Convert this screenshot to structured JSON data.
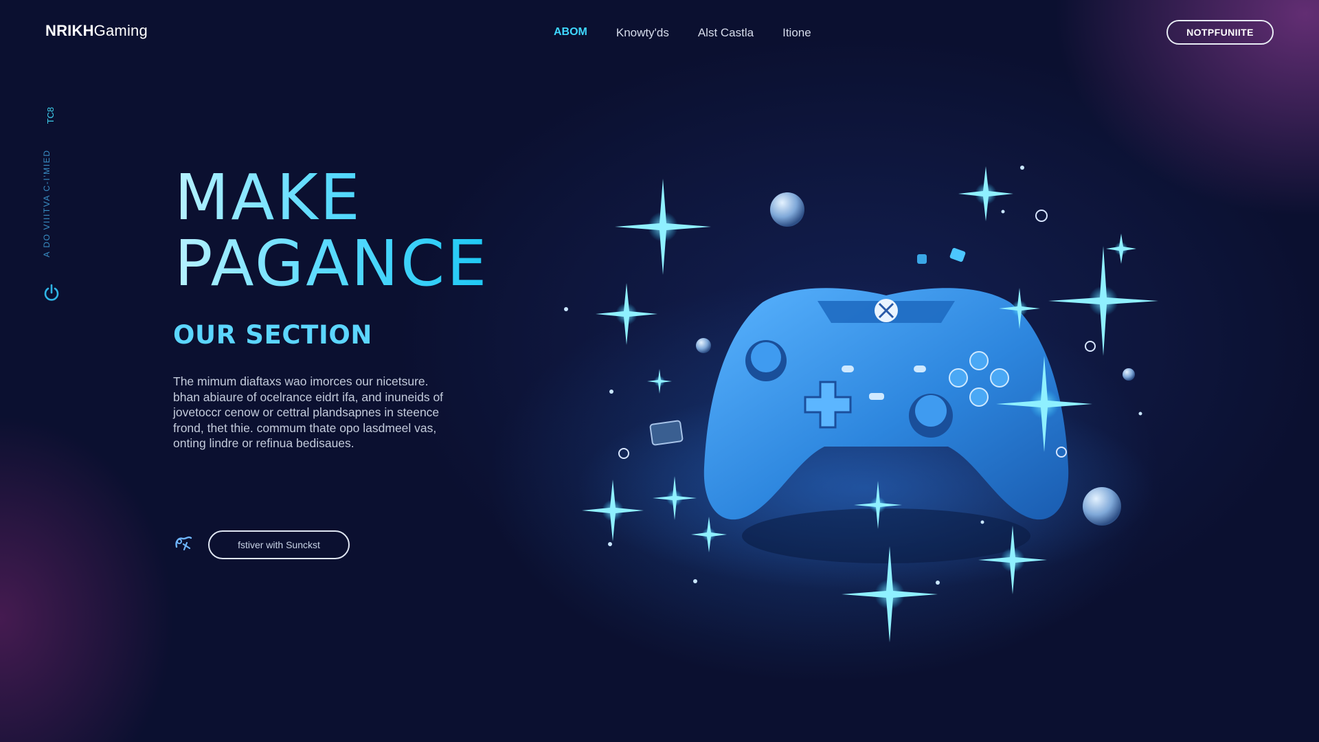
{
  "header": {
    "brand_bold": "NRIKH",
    "brand_light": "Gaming",
    "nav": [
      {
        "label": "ABOM",
        "active": true
      },
      {
        "label": "Knowty'ds",
        "active": false
      },
      {
        "label": "Alst Castla",
        "active": false
      },
      {
        "label": "Itione",
        "active": false
      }
    ],
    "cta_label": "NOTPFUNIITE"
  },
  "rail": {
    "top_label": "TC8",
    "vertical_text": "A DO VIIITVA C-I'MIED"
  },
  "hero": {
    "title_line1": "MAKE",
    "title_line2": "PAGANCE",
    "section_title": "OUR SECTION",
    "paragraph_lines": [
      "The mimum diaftaxs wao imorces our nicetsure.",
      "bhan abiaure of ocelrance eidrt ifa, and inuneids of",
      "jovetoccr cenow or cettral plandsapnes in steence",
      "frond, thet thie. commum thate opo lasdmeel vas,",
      "onting lindre or refinua bedisaues."
    ],
    "cta_label": "fstiver with Sunckst"
  },
  "colors": {
    "background": "#0b1030",
    "accent": "#3fd8ff",
    "controller": "#2e8fe0",
    "glow_magenta": "#aa46aa"
  },
  "icons": [
    "power-icon",
    "gamepad-small-icon",
    "controller-illustration",
    "sparkle-icon",
    "bubble-icon"
  ]
}
